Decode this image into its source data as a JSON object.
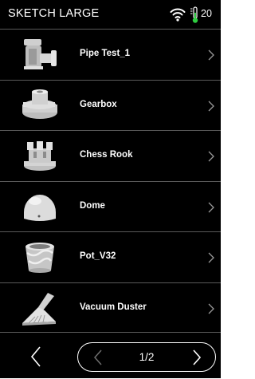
{
  "header": {
    "title": "SKETCH LARGE",
    "temperature": "20"
  },
  "items": [
    {
      "label": "Pipe Test_1",
      "icon": "pipe-model-icon"
    },
    {
      "label": "Gearbox",
      "icon": "gear-model-icon"
    },
    {
      "label": "Chess Rook",
      "icon": "rook-model-icon"
    },
    {
      "label": "Dome",
      "icon": "dome-model-icon"
    },
    {
      "label": "Pot_V32",
      "icon": "pot-model-icon"
    },
    {
      "label": "Vacuum Duster",
      "icon": "duster-model-icon"
    }
  ],
  "footer": {
    "page_indicator": "1/2"
  },
  "colors": {
    "background": "#000000",
    "text": "#ffffff",
    "divider": "#5a5a5a",
    "disabled": "#6e6e6e"
  }
}
